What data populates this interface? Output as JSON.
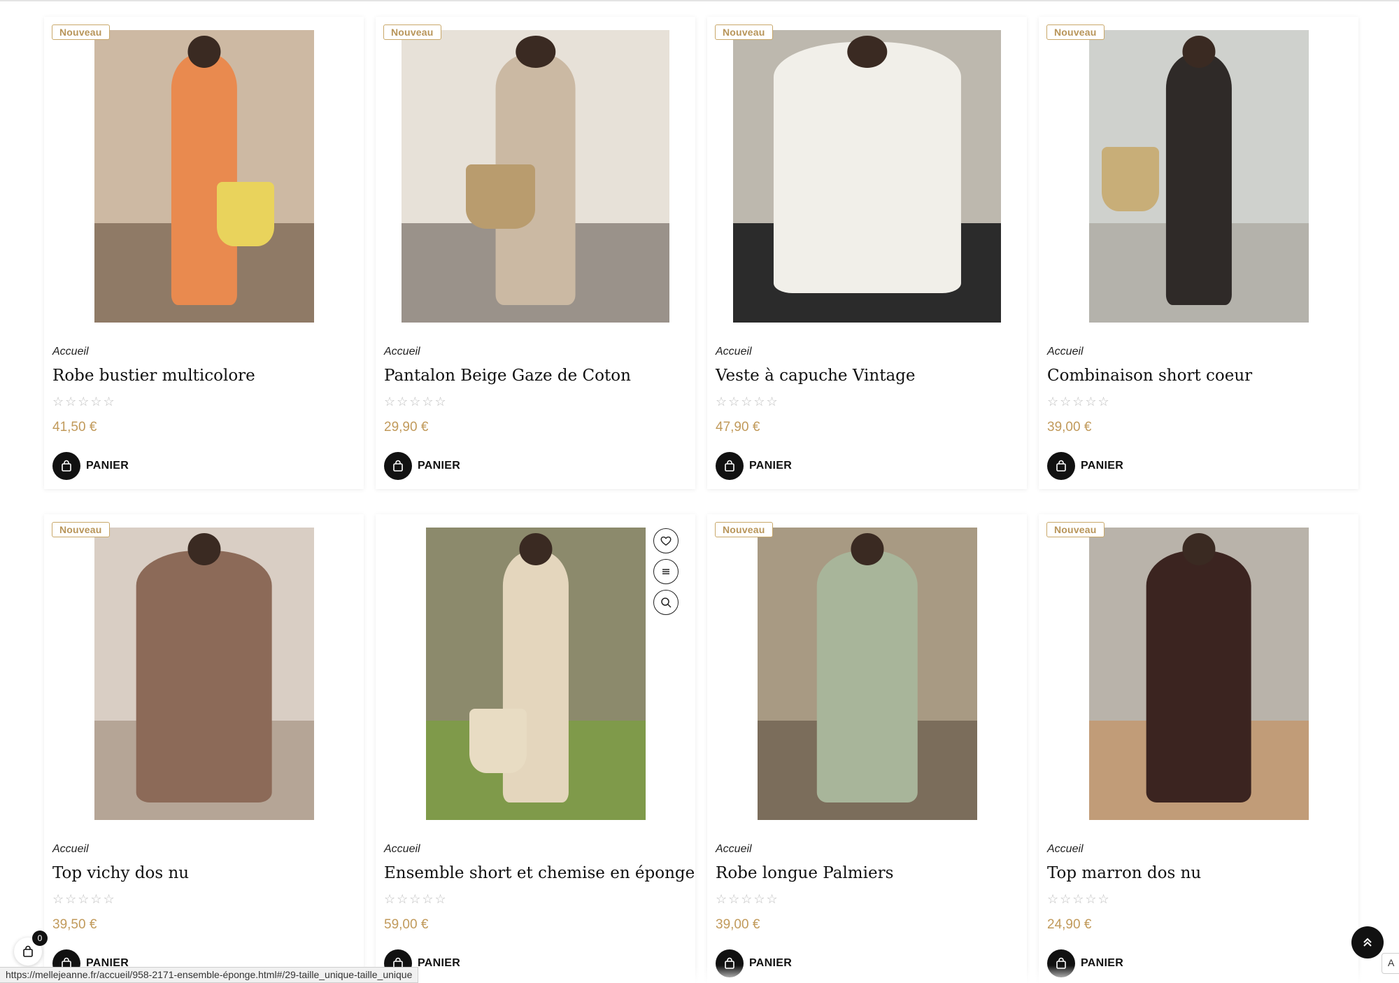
{
  "products": [
    {
      "badge": "Nouveau",
      "category": "Accueil",
      "name": "Robe bustier multicolore",
      "stars": "☆☆☆☆☆",
      "price": "41,50 €",
      "cart_label": "PANIER",
      "palette": {
        "bg": "#cdb9a3",
        "floor": "#8f7a66",
        "figure": "#e98a4f",
        "bag": "#e9d35c"
      }
    },
    {
      "badge": "Nouveau",
      "category": "Accueil",
      "name": "Pantalon Beige Gaze de Coton",
      "stars": "☆☆☆☆☆",
      "price": "29,90 €",
      "cart_label": "PANIER",
      "palette": {
        "bg": "#e7e1d8",
        "floor": "#9a928a",
        "figure": "#cbb9a3",
        "bag": "#b99c6e"
      }
    },
    {
      "badge": "Nouveau",
      "category": "Accueil",
      "name": "Veste à capuche Vintage",
      "stars": "☆☆☆☆☆",
      "price": "47,90 €",
      "cart_label": "PANIER",
      "palette": {
        "bg": "#bdb8ae",
        "floor": "#2b2b2b",
        "figure": "#f1efe9",
        "bag": "#bdb8ae"
      }
    },
    {
      "badge": "Nouveau",
      "category": "Accueil",
      "name": "Combinaison short coeur",
      "stars": "☆☆☆☆☆",
      "price": "39,00 €",
      "cart_label": "PANIER",
      "palette": {
        "bg": "#cfd1cd",
        "floor": "#b4b2ab",
        "figure": "#2f2a28",
        "bag": "#c8ae78"
      }
    },
    {
      "badge": "Nouveau",
      "category": "Accueil",
      "name": "Top vichy dos nu",
      "stars": "☆☆☆☆☆",
      "price": "39,50 €",
      "cart_label": "PANIER",
      "palette": {
        "bg": "#d9cec4",
        "floor": "#b5a596",
        "figure": "#8c6a58",
        "bag": "#d9cec4"
      }
    },
    {
      "badge": "",
      "category": "Accueil",
      "name": "Ensemble short et chemise en éponge",
      "stars": "☆☆☆☆☆",
      "price": "59,00 €",
      "cart_label": "PANIER",
      "palette": {
        "bg": "#8c8a6c",
        "floor": "#7f9a4a",
        "figure": "#e4d6bd",
        "bag": "#e8dcc3"
      }
    },
    {
      "badge": "Nouveau",
      "category": "Accueil",
      "name": "Robe longue Palmiers",
      "stars": "☆☆☆☆☆",
      "price": "39,00 €",
      "cart_label": "PANIER",
      "palette": {
        "bg": "#a89a83",
        "floor": "#7b6d5b",
        "figure": "#a8b59a",
        "bag": "#a89a83"
      }
    },
    {
      "badge": "Nouveau",
      "category": "Accueil",
      "name": "Top marron dos nu",
      "stars": "☆☆☆☆☆",
      "price": "24,90 €",
      "cart_label": "PANIER",
      "palette": {
        "bg": "#b9b3aa",
        "floor": "#c19c78",
        "figure": "#3b2420",
        "bag": "#b9b3aa"
      }
    }
  ],
  "quick_actions": [
    "heart-icon",
    "compare-icon",
    "search-icon"
  ],
  "cart": {
    "count": "0"
  },
  "status_url": "https://mellejeanne.fr/accueil/958-2171-ensemble-éponge.html#/29-taille_unique-taille_unique",
  "corner_text": "A",
  "colors": {
    "accent": "#c19a5b",
    "badge_border": "#c9a86a",
    "button": "#111111"
  }
}
